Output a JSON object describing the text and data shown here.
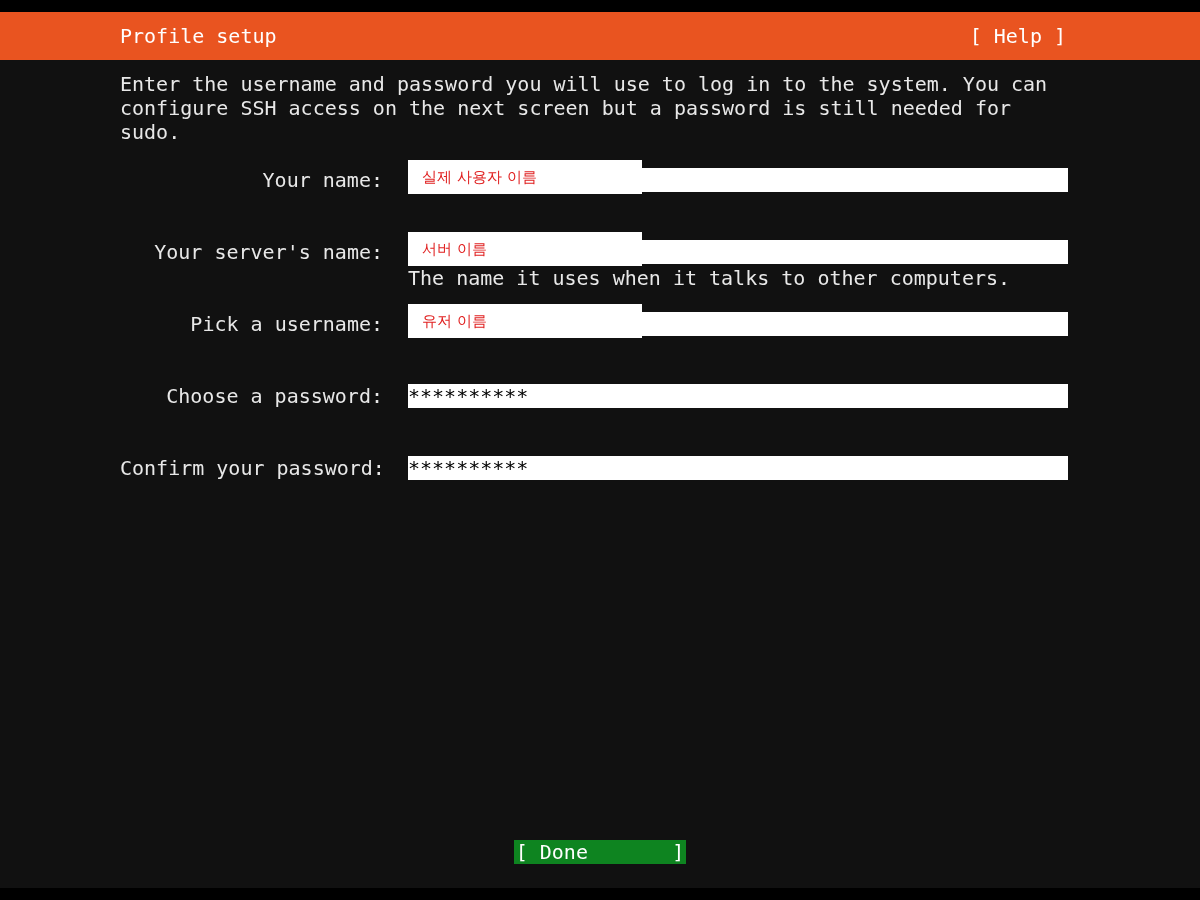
{
  "header": {
    "title": "Profile setup",
    "help": "[ Help ]"
  },
  "intro": "Enter the username and password you will use to log in to the system. You can configure SSH access on the next screen but a password is still needed for sudo.",
  "fields": [
    {
      "label": "Your name:",
      "kind": "annotated",
      "value": "실제 사용자 이름"
    },
    {
      "label": "Your server's name:",
      "kind": "annotated",
      "value": "서버 이름",
      "hint": "The name it uses when it talks to other computers."
    },
    {
      "label": "Pick a username:",
      "kind": "annotated",
      "value": "유저 이름"
    },
    {
      "label": "Choose a password:",
      "kind": "text",
      "value": "**********"
    },
    {
      "label": "Confirm your password:",
      "kind": "text",
      "value": "**********"
    }
  ],
  "done_button": "[ Done       ]"
}
